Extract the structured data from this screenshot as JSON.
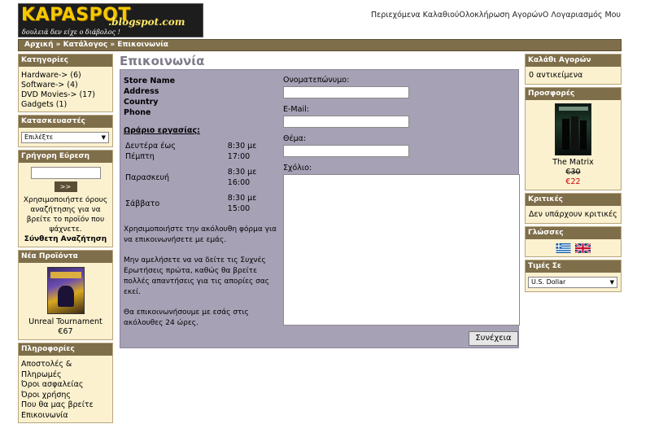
{
  "header": {
    "logo_main": "KAPASPOT",
    "logo_sub": ".blogspot.com",
    "logo_tag": "δουλειά δεν είχε ο διάβολος !",
    "links": "Περιεχόμενα ΚαλαθιούΟλοκλήρωση ΑγορώνΟ Λογαριασμός Μου"
  },
  "breadcrumb": "Αρχική » Κατάλογος » Επικοινωνία",
  "left": {
    "categories": {
      "title": "Κατηγορίες",
      "items": [
        "Hardware-> (6)",
        "Software-> (4)",
        "DVD Movies-> (17)",
        "Gadgets (1)"
      ]
    },
    "manufacturers": {
      "title": "Κατασκευαστές",
      "select_value": "Επιλέξτε"
    },
    "quick_search": {
      "title": "Γρήγορη Εύρεση",
      "button": ">>",
      "help": "Χρησιμοποιήστε όρους αναζήτησης για να βρείτε το προϊόν που ψάχνετε.",
      "advanced": "Σύνθετη Αναζήτηση"
    },
    "new_products": {
      "title": "Νέα Προϊόντα",
      "name": "Unreal Tournament",
      "price": "€67"
    },
    "information": {
      "title": "Πληροφορίες",
      "items": [
        "Αποστολές & Πληρωμές",
        "Όροι ασφαλείας",
        "Όροι χρήσης",
        "Που θα μας βρείτε",
        "Επικοινωνία"
      ]
    }
  },
  "main": {
    "title": "Επικοινωνία",
    "store": [
      "Store Name",
      "Address",
      "Country",
      "Phone"
    ],
    "hours_title": "Ωράριο εργασίας:",
    "hours": [
      {
        "day": "Δευτέρα έως Πέμπτη",
        "time": "8:30 με 17:00"
      },
      {
        "day": "Παρασκευή",
        "time": "8:30 με 16:00"
      },
      {
        "day": "Σάββατο",
        "time": "8:30 με 15:00"
      }
    ],
    "message": [
      "Χρησιμοποιήστε την ακόλουθη φόρμα για να επικοινωνήσετε με εμάς.",
      "Μην αμελήσετε να να δείτε τις Συχνές Ερωτήσεις πρώτα, καθώς θα βρείτε πολλές απαντήσεις για τις απορίες σας εκεί.",
      "Θα επικοινωνήσουμε με εσάς στις ακόλουθες 24 ώρες."
    ],
    "form": {
      "name_label": "Ονοματεπώνυμο:",
      "email_label": "E-Mail:",
      "subject_label": "Θέμα:",
      "comment_label": "Σχόλιο:",
      "submit": "Συνέχεια"
    }
  },
  "right": {
    "cart": {
      "title": "Καλάθι Αγορών",
      "text": "0 αντικείμενα"
    },
    "specials": {
      "title": "Προσφορές",
      "name": "The Matrix",
      "old_price": "€30",
      "new_price": "€22"
    },
    "reviews": {
      "title": "Κριτικές",
      "text": "Δεν υπάρχουν κριτικές"
    },
    "languages": {
      "title": "Γλώσσες"
    },
    "currency": {
      "title": "Τιμές Σε",
      "value": "U.S. Dollar"
    }
  },
  "colors": {
    "bar": "#7f6e4a",
    "box_bg": "#fbf1cf",
    "panel": "#a7a1b6",
    "price_special": "#cc0000"
  }
}
